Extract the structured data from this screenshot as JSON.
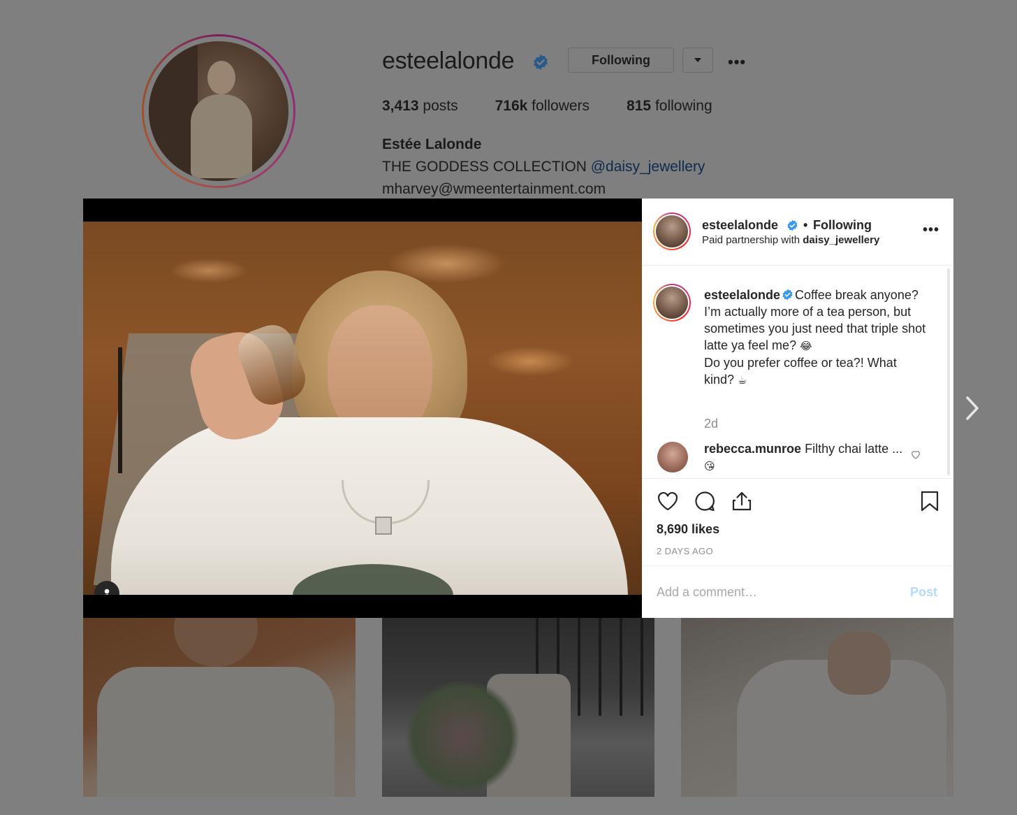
{
  "profile": {
    "username": "esteelalonde",
    "following_label": "Following",
    "more_label": "•••",
    "stats": [
      {
        "value": "3,413",
        "label": "posts"
      },
      {
        "value": "716k",
        "label": "followers"
      },
      {
        "value": "815",
        "label": "following"
      }
    ],
    "full_name": "Estée Lalonde",
    "bio_text": "THE GODDESS COLLECTION ",
    "bio_mention": "@daisy_jewellery",
    "bio_email": "mharvey@wmeentertainment.com"
  },
  "post": {
    "header": {
      "username": "esteelalonde",
      "dot": "•",
      "following_label": "Following",
      "partnership_prefix": "Paid partnership with ",
      "partner": "daisy_jewellery",
      "more_label": "•••"
    },
    "caption": {
      "username": "esteelalonde",
      "text_1": "Coffee break anyone? I’m actually more of a tea person, but sometimes you just need that triple shot latte ya feel me?",
      "emoji_1": "😂",
      "text_2": "Do you prefer coffee or tea?! What kind?",
      "emoji_2": "☕",
      "time": "2d"
    },
    "comments": [
      {
        "username": "rebecca.munroe",
        "text": "Filthy chai latte ...",
        "emoji": "😘"
      }
    ],
    "likes": "8,690 likes",
    "timestamp": "2 DAYS AGO",
    "add_comment_placeholder": "Add a comment…",
    "post_label": "Post"
  },
  "colors": {
    "verified": "#3897f0",
    "link": "#003569",
    "post_disabled": "#b3dbff",
    "overlay": "#7f7f7f"
  },
  "icons": [
    "verified-badge-icon",
    "chevron-down-icon",
    "more-icon",
    "user-tag-icon",
    "heart-icon",
    "comment-icon",
    "share-icon",
    "bookmark-icon",
    "small-heart-icon",
    "chevron-right-icon"
  ]
}
